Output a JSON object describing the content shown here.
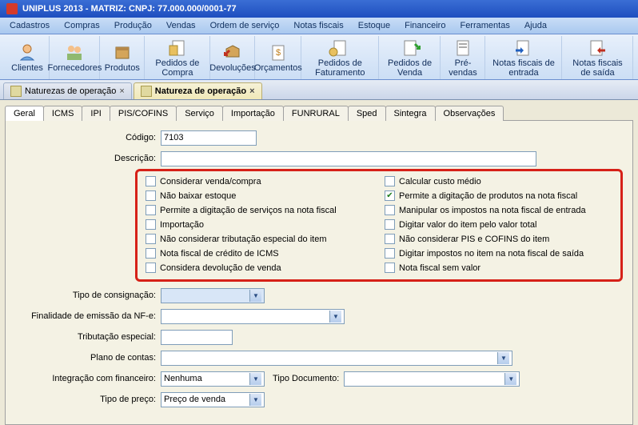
{
  "title": "UNIPLUS  2013 - MATRIZ:        CNPJ: 77.000.000/0001-77",
  "menu": [
    "Cadastros",
    "Compras",
    "Produção",
    "Vendas",
    "Ordem de serviço",
    "Notas fiscais",
    "Estoque",
    "Financeiro",
    "Ferramentas",
    "Ajuda"
  ],
  "toolbar": [
    {
      "label": "Clientes"
    },
    {
      "label": "Fornecedores"
    },
    {
      "label": "Produtos"
    },
    {
      "label": "Pedidos de Compra"
    },
    {
      "label": "Devoluções"
    },
    {
      "label": "Orçamentos"
    },
    {
      "label": "Pedidos de Faturamento"
    },
    {
      "label": "Pedidos de Venda"
    },
    {
      "label": "Pré-vendas"
    },
    {
      "label": "Notas fiscais de entrada"
    },
    {
      "label": "Notas fiscais de saída"
    }
  ],
  "doctabs": [
    {
      "label": "Naturezas de operação",
      "active": false
    },
    {
      "label": "Natureza de operação",
      "active": true
    }
  ],
  "innertabs": [
    "Geral",
    "ICMS",
    "IPI",
    "PIS/COFINS",
    "Serviço",
    "Importação",
    "FUNRURAL",
    "Sped",
    "Sintegra",
    "Observações"
  ],
  "activeInnerTab": "Geral",
  "form": {
    "codigo_label": "Código:",
    "codigo_value": "7103",
    "descricao_label": "Descrição:",
    "descricao_value": "",
    "checks_left": [
      {
        "label": "Considerar venda/compra",
        "checked": false
      },
      {
        "label": "Não baixar estoque",
        "checked": false
      },
      {
        "label": "Permite a digitação de serviços na nota fiscal",
        "checked": false
      },
      {
        "label": "Importação",
        "checked": false
      },
      {
        "label": "Não considerar tributação especial do item",
        "checked": false
      },
      {
        "label": "Nota fiscal de crédito de ICMS",
        "checked": false
      },
      {
        "label": "Considera devolução de venda",
        "checked": false
      }
    ],
    "checks_right": [
      {
        "label": "Calcular custo médio",
        "checked": false
      },
      {
        "label": "Permite a digitação de produtos na nota fiscal",
        "checked": true
      },
      {
        "label": "Manipular os impostos na nota fiscal de entrada",
        "checked": false
      },
      {
        "label": "Digitar valor do item pelo valor total",
        "checked": false
      },
      {
        "label": "Não considerar PIS e COFINS do item",
        "checked": false
      },
      {
        "label": "Digitar impostos no item na nota fiscal de saída",
        "checked": false
      },
      {
        "label": "Nota fiscal sem valor",
        "checked": false
      }
    ],
    "tipo_consignacao_label": "Tipo de consignação:",
    "tipo_consignacao_value": "",
    "finalidade_label": "Finalidade de emissão da NF-e:",
    "finalidade_value": "",
    "tributacao_label": "Tributação especial:",
    "tributacao_value": "",
    "plano_label": "Plano de contas:",
    "plano_value": "",
    "integracao_label": "Integração com financeiro:",
    "integracao_value": "Nenhuma",
    "tipo_doc_label": "Tipo Documento:",
    "tipo_doc_value": "",
    "tipo_preco_label": "Tipo de preço:",
    "tipo_preco_value": "Preço de venda"
  }
}
